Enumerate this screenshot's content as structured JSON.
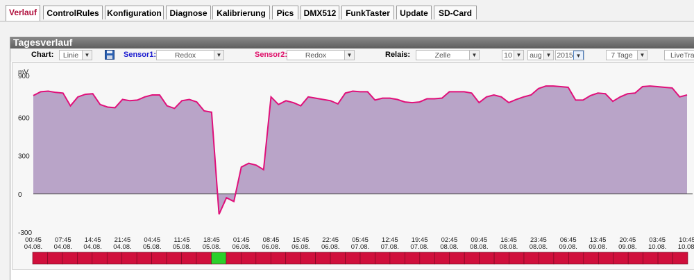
{
  "tabs": [
    {
      "label": "Verlauf",
      "active": true
    },
    {
      "label": "ControlRules"
    },
    {
      "label": "Konfiguration"
    },
    {
      "label": "Diagnose"
    },
    {
      "label": "Kalibrierung"
    },
    {
      "label": "Pics"
    },
    {
      "label": "DMX512"
    },
    {
      "label": "FunkTaster"
    },
    {
      "label": "Update"
    },
    {
      "label": "SD-Card"
    }
  ],
  "panel": {
    "title": "Tagesverlauf"
  },
  "toolbar": {
    "chart_label": "Chart:",
    "chart_value": "Linie",
    "sensor1_label": "Sensor1:",
    "sensor1_value": "Redox",
    "sensor2_label": "Sensor2:",
    "sensor2_value": "Redox",
    "relais_label": "Relais:",
    "relais_value": "Zelle",
    "day_value": "10",
    "month_value": "aug",
    "year_value": "2015",
    "range_value": "7 Tage",
    "live_value": "LiveTra",
    "colors": {
      "sensor1": "#1c1cd0",
      "sensor2": "#e0106a"
    }
  },
  "chart_data": {
    "type": "area",
    "ylabel": "mV",
    "y_ticks": [
      "900",
      "600",
      "300",
      "0",
      "-300"
    ],
    "ylim": [
      -300,
      900
    ],
    "x_labels": [
      {
        "time": "00:45",
        "date": "04.08."
      },
      {
        "time": "07:45",
        "date": "04.08."
      },
      {
        "time": "14:45",
        "date": "04.08."
      },
      {
        "time": "21:45",
        "date": "04.08."
      },
      {
        "time": "04:45",
        "date": "05.08."
      },
      {
        "time": "11:45",
        "date": "05.08."
      },
      {
        "time": "18:45",
        "date": "05.08."
      },
      {
        "time": "01:45",
        "date": "06.08."
      },
      {
        "time": "08:45",
        "date": "06.08."
      },
      {
        "time": "15:45",
        "date": "06.08."
      },
      {
        "time": "22:45",
        "date": "06.08."
      },
      {
        "time": "05:45",
        "date": "07.08."
      },
      {
        "time": "12:45",
        "date": "07.08."
      },
      {
        "time": "19:45",
        "date": "07.08."
      },
      {
        "time": "02:45",
        "date": "08.08."
      },
      {
        "time": "09:45",
        "date": "08.08."
      },
      {
        "time": "16:45",
        "date": "08.08."
      },
      {
        "time": "23:45",
        "date": "08.08."
      },
      {
        "time": "06:45",
        "date": "09.08."
      },
      {
        "time": "13:45",
        "date": "09.08."
      },
      {
        "time": "20:45",
        "date": "09.08."
      },
      {
        "time": "03:45",
        "date": "10.08."
      },
      {
        "time": "10:45",
        "date": "10.08."
      }
    ],
    "series": [
      {
        "color": "#e0107a",
        "fill": "#b9a4c8",
        "values": [
          770,
          800,
          805,
          795,
          790,
          690,
          760,
          780,
          785,
          700,
          680,
          675,
          740,
          730,
          735,
          760,
          775,
          775,
          690,
          670,
          730,
          740,
          720,
          650,
          640,
          -160,
          -30,
          -60,
          210,
          240,
          225,
          190,
          760,
          700,
          730,
          715,
          690,
          760,
          750,
          740,
          730,
          705,
          790,
          805,
          800,
          800,
          735,
          750,
          750,
          740,
          720,
          715,
          720,
          745,
          745,
          750,
          800,
          800,
          800,
          790,
          715,
          760,
          775,
          760,
          715,
          740,
          760,
          775,
          825,
          845,
          845,
          840,
          835,
          735,
          735,
          770,
          790,
          785,
          725,
          760,
          785,
          790,
          840,
          845,
          840,
          835,
          830,
          760,
          775
        ]
      }
    ],
    "relay_segments": {
      "count": 44,
      "active_index": 12,
      "off_color": "#d0103c",
      "on_color": "#2ad02a"
    }
  }
}
